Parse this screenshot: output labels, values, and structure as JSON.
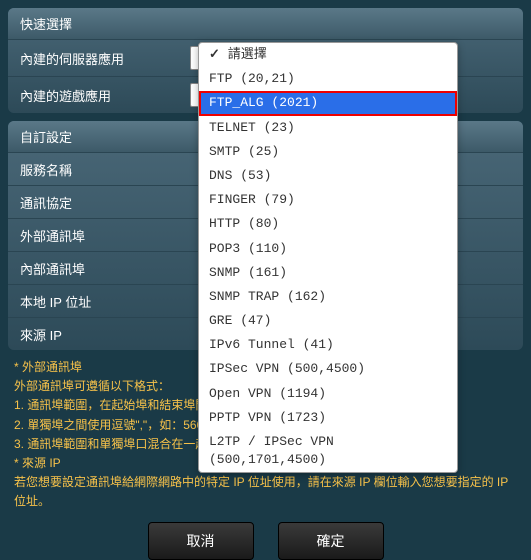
{
  "quickSelect": {
    "header": "快速選擇",
    "serverApp": {
      "label": "內建的伺服器應用",
      "value": ""
    },
    "gameApp": {
      "label": "內建的遊戲應用"
    }
  },
  "customSettings": {
    "header": "自訂設定",
    "fields": {
      "serviceName": "服務名稱",
      "protocol": "通訊協定",
      "externalPort": "外部通訊埠",
      "internalPort": "內部通訊埠",
      "localIp": "本地 IP 位址",
      "sourceIp": "來源 IP"
    }
  },
  "dropdown": {
    "items": [
      "請選擇",
      "FTP (20,21)",
      "FTP_ALG (2021)",
      "TELNET (23)",
      "SMTP (25)",
      "DNS (53)",
      "FINGER (79)",
      "HTTP (80)",
      "POP3 (110)",
      "SNMP (161)",
      "SNMP TRAP (162)",
      "GRE (47)",
      "IPv6 Tunnel (41)",
      "IPSec VPN (500,4500)",
      "Open VPN (1194)",
      "PPTP VPN (1723)",
      "L2TP / IPSec VPN (500,1701,4500)"
    ],
    "selectedIndex": 0,
    "highlightedIndex": 2
  },
  "footnotes": {
    "externalPort": {
      "title": "* 外部通訊埠",
      "lines": [
        "外部通訊埠可遵循以下格式：",
        "1. 通訊埠範圍，在起始埠和結束埠間使用冒號\":\"，如： 300:350。",
        "2. 單獨埠之間使用逗號\",\"，如：566,789。",
        "3. 通訊埠範圍和單獨埠口混合在一起，使用冒號\":\"和逗號\",\"，如：1015:1024, 3021。"
      ]
    },
    "sourceIp": {
      "title": "* 來源 IP",
      "lines": [
        "若您想要設定通訊埠給網際網路中的特定 IP 位址使用，請在來源 IP 欄位輸入您想要指定的 IP 位址。"
      ]
    }
  },
  "buttons": {
    "cancel": "取消",
    "confirm": "確定"
  }
}
